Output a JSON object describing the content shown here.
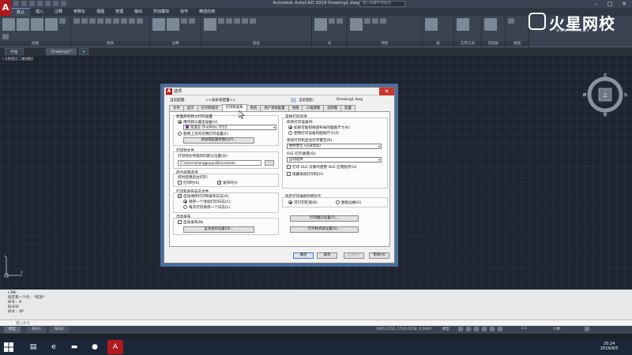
{
  "app": {
    "window_title": "Autodesk AutoCAD 2019   Drawing1.dwg",
    "search_placeholder": "键入关键字或短语"
  },
  "menubar": [
    "默认",
    "插入",
    "注释",
    "参数化",
    "视图",
    "管理",
    "输出",
    "附加模块",
    "协作",
    "精选应用"
  ],
  "ribbon_panels": [
    "绘图",
    "修改",
    "注释",
    "图层",
    "块",
    "特性",
    "组",
    "实用工具",
    "剪贴板",
    "视图"
  ],
  "doc_tabs": [
    "开始",
    "Drawing1*"
  ],
  "watermark": {
    "brand": "火星网校",
    "url": "www.hxsd.tv"
  },
  "viewport_label": "[-][俯视][二维线框]",
  "viewcube": {
    "north": "北",
    "south": "南",
    "east": "东",
    "west": "西",
    "top": "上"
  },
  "command_history": [
    "LINE",
    "指定第一个点: *取消*",
    "命令: D",
    "BLOCK",
    "命令: OP"
  ],
  "command_prompt": "键入命令",
  "layout_tabs": [
    "模型",
    "布局1",
    "布局2"
  ],
  "status": {
    "coords": "2665.2155, 1510.0228, 0.0000",
    "model": "模型",
    "scale": "1:1",
    "mode": "小数"
  },
  "taskbar": {
    "time": "20:24",
    "date": "2019/9/5"
  },
  "dialog": {
    "title": "选项",
    "current_profile_label": "当前配置:",
    "current_profile_value": "<<未命名配置>>",
    "current_drawing_label": "当前图形:",
    "current_drawing_value": "Drawing1.dwg",
    "tabs": [
      "文件",
      "显示",
      "打开和保存",
      "打印和发布",
      "系统",
      "用户系统配置",
      "绘图",
      "三维建模",
      "选择集",
      "配置"
    ],
    "selected_tab": "打印和发布",
    "left": {
      "default_device_title": "新图形的默认打印设置",
      "opt_default_device": "用作默认输出设备(V)",
      "device_value": "发送至 OneNote 2013",
      "opt_last_used": "使用上次的可用打印设置(F)",
      "add_plotter_btn": "添加或配置绘图仪(P)...",
      "plot_file_title": "打印到文件",
      "plot_file_location_label": "打印到文件操作的默认位置(D):",
      "plot_file_path": "C:\\Users\\zhangguoyu\\Documents",
      "browse_btn": "...",
      "bg_title": "后台处理选项",
      "bg_subtitle": "何时启用后台打印:",
      "bg_plotting": "打印时(K)",
      "bg_publishing": "发布时(I)",
      "log_title": "打印和发布日志文件",
      "log_auto_save": "自动保存打印和发布日志(A)",
      "log_continuous": "保存一个连续打印日志(C)",
      "log_per_plot": "每次打印保存一个日志(L)",
      "autopublish_title": "自动发布",
      "autopublish_check": "自动发布(N)",
      "autopublish_btn": "自动发布设置(O)..."
    },
    "right": {
      "general_title": "常规打印选项",
      "paper_change_title": "修改打印设备时:",
      "keep_layout_paper": "如果可能则保留布局的图纸尺寸(K)",
      "use_device_paper": "使用打印设备的图纸尺寸(Z)",
      "spool_alert_label": "系统打印机后台打印警告(R):",
      "spool_alert_value": "始终警告 (记录错误)",
      "ole_quality_label": "OLE 打印质量(Q):",
      "ole_quality_value": "自动选择",
      "ole_app_check": "打印 OLE 对象时使用 OLE 应用程序(U)",
      "hide_system_printers": "隐藏系统打印机(H)",
      "offset_title": "指定打印偏移时相对于",
      "offset_printable": "可打印区域(B)",
      "offset_edge": "图纸边缘(G)",
      "plot_stamp_btn": "打印戳记设置(T)...",
      "plot_style_btn": "打印样式表设置(S)..."
    },
    "buttons": {
      "ok": "确定",
      "cancel": "取消",
      "apply": "应用(A)",
      "help": "帮助(H)"
    }
  }
}
